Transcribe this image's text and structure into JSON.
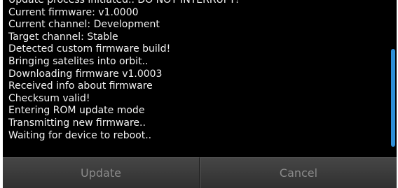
{
  "log": {
    "lines": [
      "Update process initiated.. DO NOT INTERRUPT!",
      "Current firmware: v1.0000",
      "Current channel: Development",
      "Target channel: Stable",
      "Detected custom firmware build!",
      "Bringing satelites into orbit..",
      "Downloading firmware v1.0003",
      "Received info about firmware",
      "Checksum valid!",
      "Entering ROM update mode",
      "Transmitting new firmware..",
      "Waiting for device to reboot.."
    ]
  },
  "buttons": {
    "update_label": "Update",
    "cancel_label": "Cancel"
  },
  "colors": {
    "log_background": "#000000",
    "log_text": "#f2f2f2",
    "scrollbar_accent": "#2f8fd8",
    "button_text_disabled": "#8a8a8a"
  }
}
